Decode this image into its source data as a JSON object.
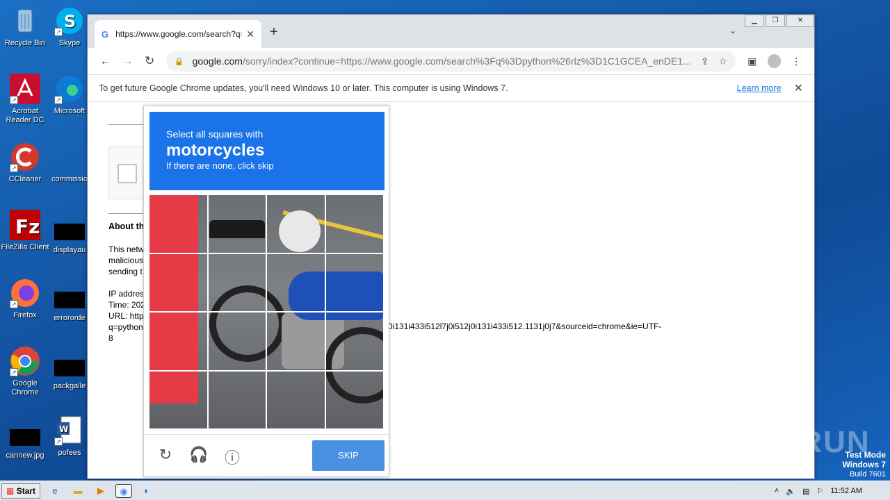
{
  "desktop": {
    "icons_left": [
      {
        "label": "Recycle Bin",
        "icon": "recycle-bin-icon",
        "color": "#7fb0e0"
      },
      {
        "label": "Acrobat Reader DC",
        "icon": "acrobat-icon",
        "color": "#c8102e"
      },
      {
        "label": "CCleaner",
        "icon": "ccleaner-icon",
        "color": "#d3382b"
      },
      {
        "label": "FileZilla Client",
        "icon": "filezilla-icon",
        "color": "#bf0000"
      },
      {
        "label": "Firefox",
        "icon": "firefox-icon",
        "color": "#ff7139"
      },
      {
        "label": "Google Chrome",
        "icon": "chrome-icon",
        "color": "#4285f4"
      },
      {
        "label": "cannew.jpg",
        "icon": "image-file-icon",
        "color": "#000000"
      }
    ],
    "icons_right": [
      {
        "label": "Skype",
        "icon": "skype-icon",
        "color": "#00aff0"
      },
      {
        "label": "Microsoft",
        "icon": "edge-icon",
        "color": "#0c7bd5"
      },
      {
        "label": "commissio",
        "icon": "file-icon",
        "color": "#1559a8"
      },
      {
        "label": "displayau",
        "icon": "file-icon",
        "color": "#000000"
      },
      {
        "label": "errororde",
        "icon": "file-icon",
        "color": "#000000"
      },
      {
        "label": "packgalle",
        "icon": "file-icon",
        "color": "#000000"
      },
      {
        "label": "pofees",
        "icon": "word-doc-icon",
        "color": "#2b579a"
      }
    ]
  },
  "browser": {
    "tab_title": "https://www.google.com/search?q=",
    "url_host": "google.com",
    "url_rest": "/sorry/index?continue=https://www.google.com/search%3Fq%3Dpython%26rlz%3D1C1GCEA_enDE1...",
    "infobar_message": "To get future Google Chrome updates, you'll need Windows 10 or later. This computer is using Windows 7.",
    "infobar_link": "Learn more"
  },
  "page": {
    "about_heading": "About th",
    "paragraph": [
      "This netw",
      "malicious",
      "sending t"
    ],
    "ip_lines": [
      "IP addres",
      "Time: 202",
      "URL: http",
      "q=python",
      "8"
    ],
    "url_tail": "0i131i433i512l7j0i512j0i131i433i512.1131j0j7&sourceid=chrome&ie=UTF-"
  },
  "captcha": {
    "line1": "Select all squares with",
    "target": "motorcycles",
    "line3": "If there are none, click skip",
    "skip_label": "SKIP",
    "accent": "#1a73e8"
  },
  "taskbar": {
    "start_label": "Start",
    "clock": "11:52 AM"
  },
  "watermark": "ANY RUN",
  "test_mode": {
    "line1": "Test Mode",
    "line2": "Windows 7",
    "line3": "Build 7601"
  }
}
